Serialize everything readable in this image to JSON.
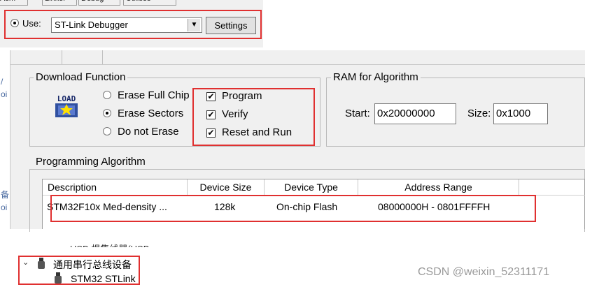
{
  "top": {
    "tabs": [
      "Asm",
      "Linker",
      "Debug",
      "Utilities"
    ],
    "use_label": "Use:",
    "debugger_value": "ST-Link Debugger",
    "settings_label": "Settings"
  },
  "download": {
    "title": "Download Function",
    "icon_text": "LOAD",
    "erase_options": [
      {
        "label": "Erase Full Chip",
        "selected": false
      },
      {
        "label": "Erase Sectors",
        "selected": true
      },
      {
        "label": "Do not Erase",
        "selected": false
      }
    ],
    "checks": [
      {
        "label": "Program",
        "checked": true
      },
      {
        "label": "Verify",
        "checked": true
      },
      {
        "label": "Reset and Run",
        "checked": true
      }
    ]
  },
  "ram": {
    "title": "RAM for Algorithm",
    "start_label": "Start:",
    "start_value": "0x20000000",
    "size_label": "Size:",
    "size_value": "0x1000"
  },
  "algorithm": {
    "title": "Programming Algorithm",
    "columns": [
      "Description",
      "Device Size",
      "Device Type",
      "Address Range"
    ],
    "rows": [
      [
        "STM32F10x Med-density ...",
        "128k",
        "On-chip Flash",
        "08000000H - 0801FFFFH"
      ]
    ]
  },
  "tree": {
    "cut_item": "USB 根集线器(USB",
    "group_label": "通用串行总线设备",
    "device_label": "STM32 STLink"
  },
  "watermark": "CSDN @weixin_52311171",
  "colors": {
    "highlight": "#e03030",
    "panel": "#f0f0f0"
  }
}
